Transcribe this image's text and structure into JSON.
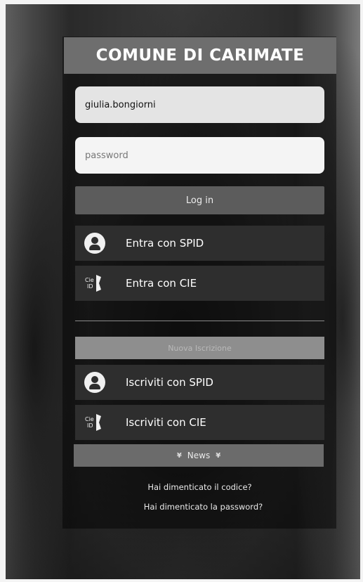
{
  "header": {
    "title": "COMUNE DI CARIMATE"
  },
  "login_form": {
    "username_value": "giulia.bongiorni",
    "password_placeholder": "password",
    "login_label": "Log in"
  },
  "access_options": [
    {
      "label": "Entra con SPID",
      "icon": "spid-user-icon"
    },
    {
      "label": "Entra con CIE",
      "icon": "cie-id-icon"
    }
  ],
  "registration": {
    "new_label": "Nuova Iscrizione",
    "options": [
      {
        "label": "Iscriviti con SPID",
        "icon": "spid-user-icon"
      },
      {
        "label": "Iscriviti con CIE",
        "icon": "cie-id-icon"
      }
    ]
  },
  "news": {
    "label": "News",
    "chevron_glyph": "¥"
  },
  "links": {
    "forgot_code": "Hai dimenticato il codice?",
    "forgot_password": "Hai dimenticato la password?"
  },
  "cie_icon_text": {
    "top": "Cie",
    "bottom": "ID"
  },
  "colors": {
    "header_bg": "#6e6e6e",
    "login_button_bg": "#5c5c5c",
    "option_button_bg": "#2e2e2e",
    "new_reg_bg": "#8e8e8e",
    "news_bg": "#6b6b6b"
  }
}
